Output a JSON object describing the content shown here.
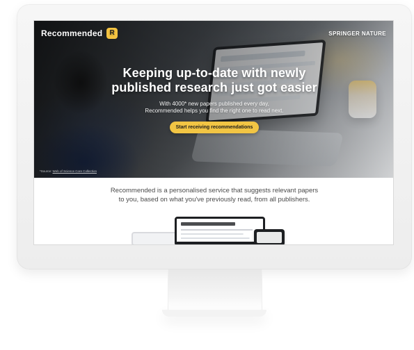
{
  "hero": {
    "brand_name": "Recommended",
    "brand_badge": "R",
    "publisher": "SPRINGER NATURE",
    "title": "Keeping up-to-date with newly\npublished research just got easier",
    "subtitle": "With 4000* new papers published every day,\nRecommended helps you find the right one to read next.",
    "cta_label": "Start receiving recommendations",
    "footnote_prefix": "*Source:",
    "footnote_link": "Web of Science Core Collection"
  },
  "content": {
    "tagline": "Recommended is a personalised service that suggests relevant papers\nto you, based on what you've previously read, from all publishers."
  },
  "icons": {
    "brand_badge": "r-badge-icon"
  },
  "colors": {
    "cta": "#f2c544",
    "brand_badge": "#f4c341"
  }
}
